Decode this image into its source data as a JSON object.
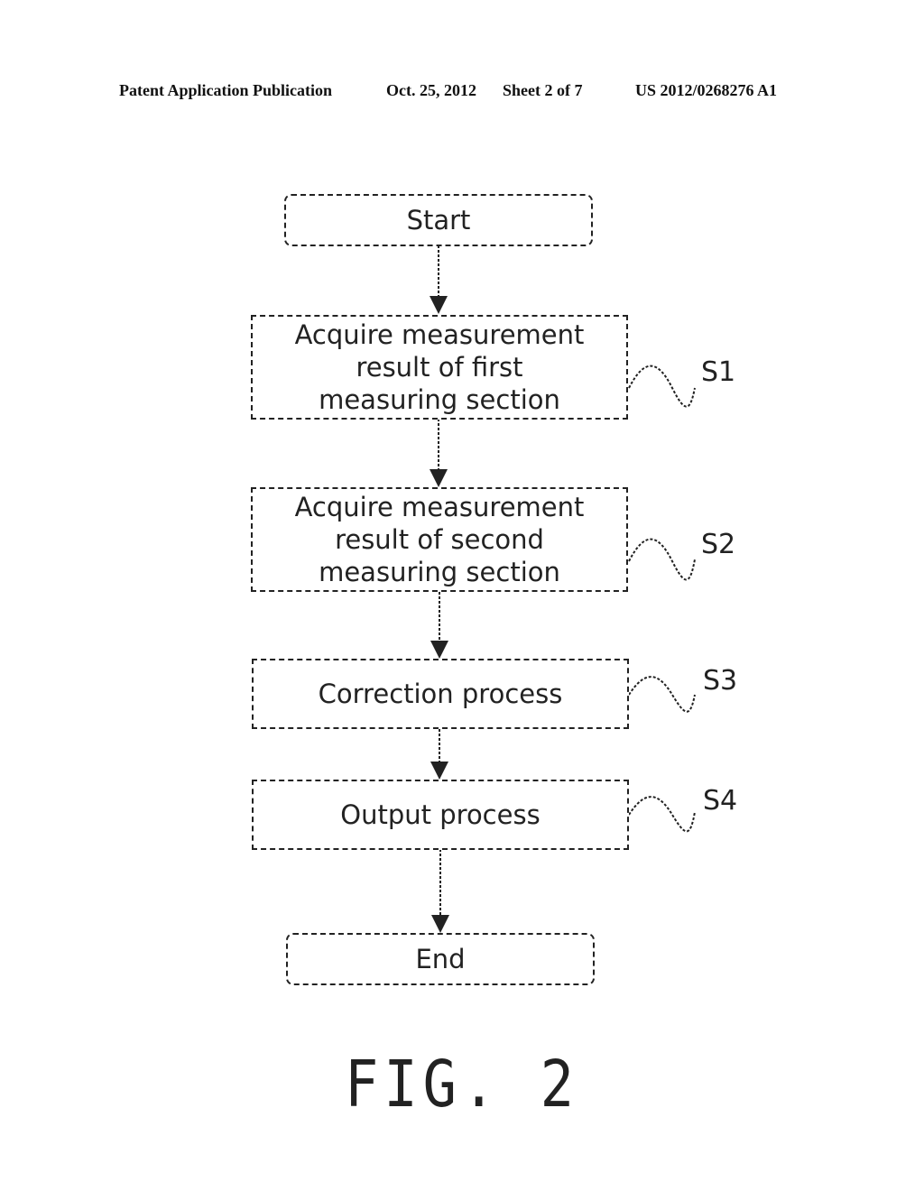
{
  "header": {
    "publication": "Patent Application Publication",
    "date": "Oct. 25, 2012",
    "sheet": "Sheet 2 of 7",
    "number": "US 2012/0268276 A1"
  },
  "flowchart": {
    "start": "Start",
    "steps": [
      {
        "label": "S1",
        "lines": [
          "Acquire measurement",
          "result of first",
          "measuring section"
        ]
      },
      {
        "label": "S2",
        "lines": [
          "Acquire measurement",
          "result of second",
          "measuring section"
        ]
      },
      {
        "label": "S3",
        "lines": [
          "Correction process"
        ]
      },
      {
        "label": "S4",
        "lines": [
          "Output process"
        ]
      }
    ],
    "end": "End"
  },
  "figure_caption": "FIG. 2"
}
